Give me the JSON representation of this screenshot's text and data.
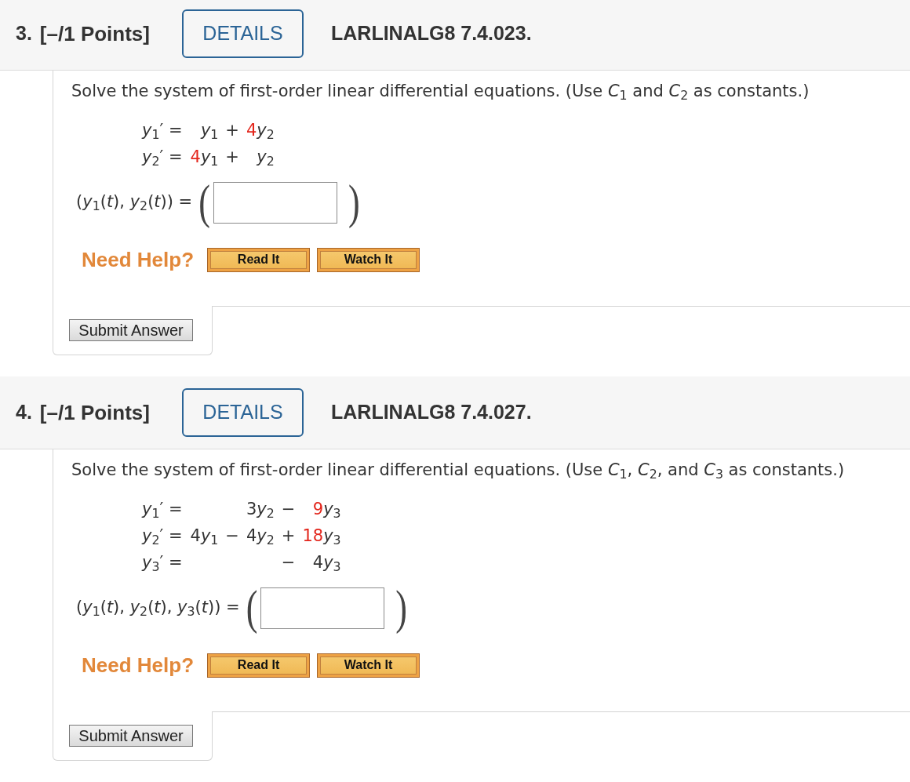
{
  "questions": [
    {
      "number": "3.",
      "points": "[–/1 Points]",
      "details_button": "DETAILS",
      "problem_code": "LARLINALG8 7.4.023.",
      "prompt": "Solve the system of first-order linear differential equations. (Use *C*$_{1}$ and *C*$_{2}$ as constants.)",
      "equations": [
        {
          "lhs": "*y*$_{1}$′ =",
          "cells": [
            {
              "kind": "term",
              "variable": "*y*$_{1}$"
            },
            {
              "kind": "operator",
              "text": "+"
            },
            {
              "kind": "term",
              "coefficient": "4",
              "highlighted": true,
              "variable": "*y*$_{2}$"
            }
          ]
        },
        {
          "lhs": "*y*$_{2}$′ =",
          "cells": [
            {
              "kind": "term",
              "coefficient": "4",
              "highlighted": true,
              "variable": "*y*$_{1}$"
            },
            {
              "kind": "operator",
              "text": "+"
            },
            {
              "kind": "term",
              "variable": "*y*$_{2}$"
            }
          ]
        }
      ],
      "answer_label": "(*y*$_{1}$(*t*), *y*$_{2}$(*t*)) =",
      "answer_open": "(",
      "answer_close": ")",
      "help_label": "Need Help?",
      "help_buttons": [
        "Read It",
        "Watch It"
      ],
      "submit_button": "Submit Answer"
    },
    {
      "number": "4.",
      "points": "[–/1 Points]",
      "details_button": "DETAILS",
      "problem_code": "LARLINALG8 7.4.027.",
      "prompt": "Solve the system of first-order linear differential equations. (Use *C*$_{1}$, *C*$_{2}$, and *C*$_{3}$ as constants.)",
      "equations": [
        {
          "lhs": "*y*$_{1}$′ =",
          "cells": [
            null,
            null,
            {
              "kind": "term",
              "coefficient": "3",
              "highlighted": false,
              "variable": "*y*$_{2}$"
            },
            {
              "kind": "operator",
              "text": "−"
            },
            {
              "kind": "term",
              "coefficient": "9",
              "highlighted": true,
              "variable": "*y*$_{3}$"
            }
          ]
        },
        {
          "lhs": "*y*$_{2}$′ =",
          "cells": [
            {
              "kind": "term",
              "coefficient": "4",
              "highlighted": false,
              "variable": "*y*$_{1}$"
            },
            {
              "kind": "operator",
              "text": "−"
            },
            {
              "kind": "term",
              "coefficient": "4",
              "highlighted": false,
              "variable": "*y*$_{2}$"
            },
            {
              "kind": "operator",
              "text": "+"
            },
            {
              "kind": "term",
              "coefficient": "18",
              "highlighted": true,
              "variable": "*y*$_{3}$"
            }
          ]
        },
        {
          "lhs": "*y*$_{3}$′ =",
          "cells": [
            null,
            null,
            null,
            {
              "kind": "operator",
              "text": "−"
            },
            {
              "kind": "term",
              "coefficient": "4",
              "highlighted": false,
              "variable": "*y*$_{3}$"
            }
          ]
        }
      ],
      "answer_label": "(*y*$_{1}$(*t*), *y*$_{2}$(*t*), *y*$_{3}$(*t*)) =",
      "answer_open": "(",
      "answer_close": ")",
      "help_label": "Need Help?",
      "help_buttons": [
        "Read It",
        "Watch It"
      ],
      "submit_button": "Submit Answer"
    }
  ]
}
